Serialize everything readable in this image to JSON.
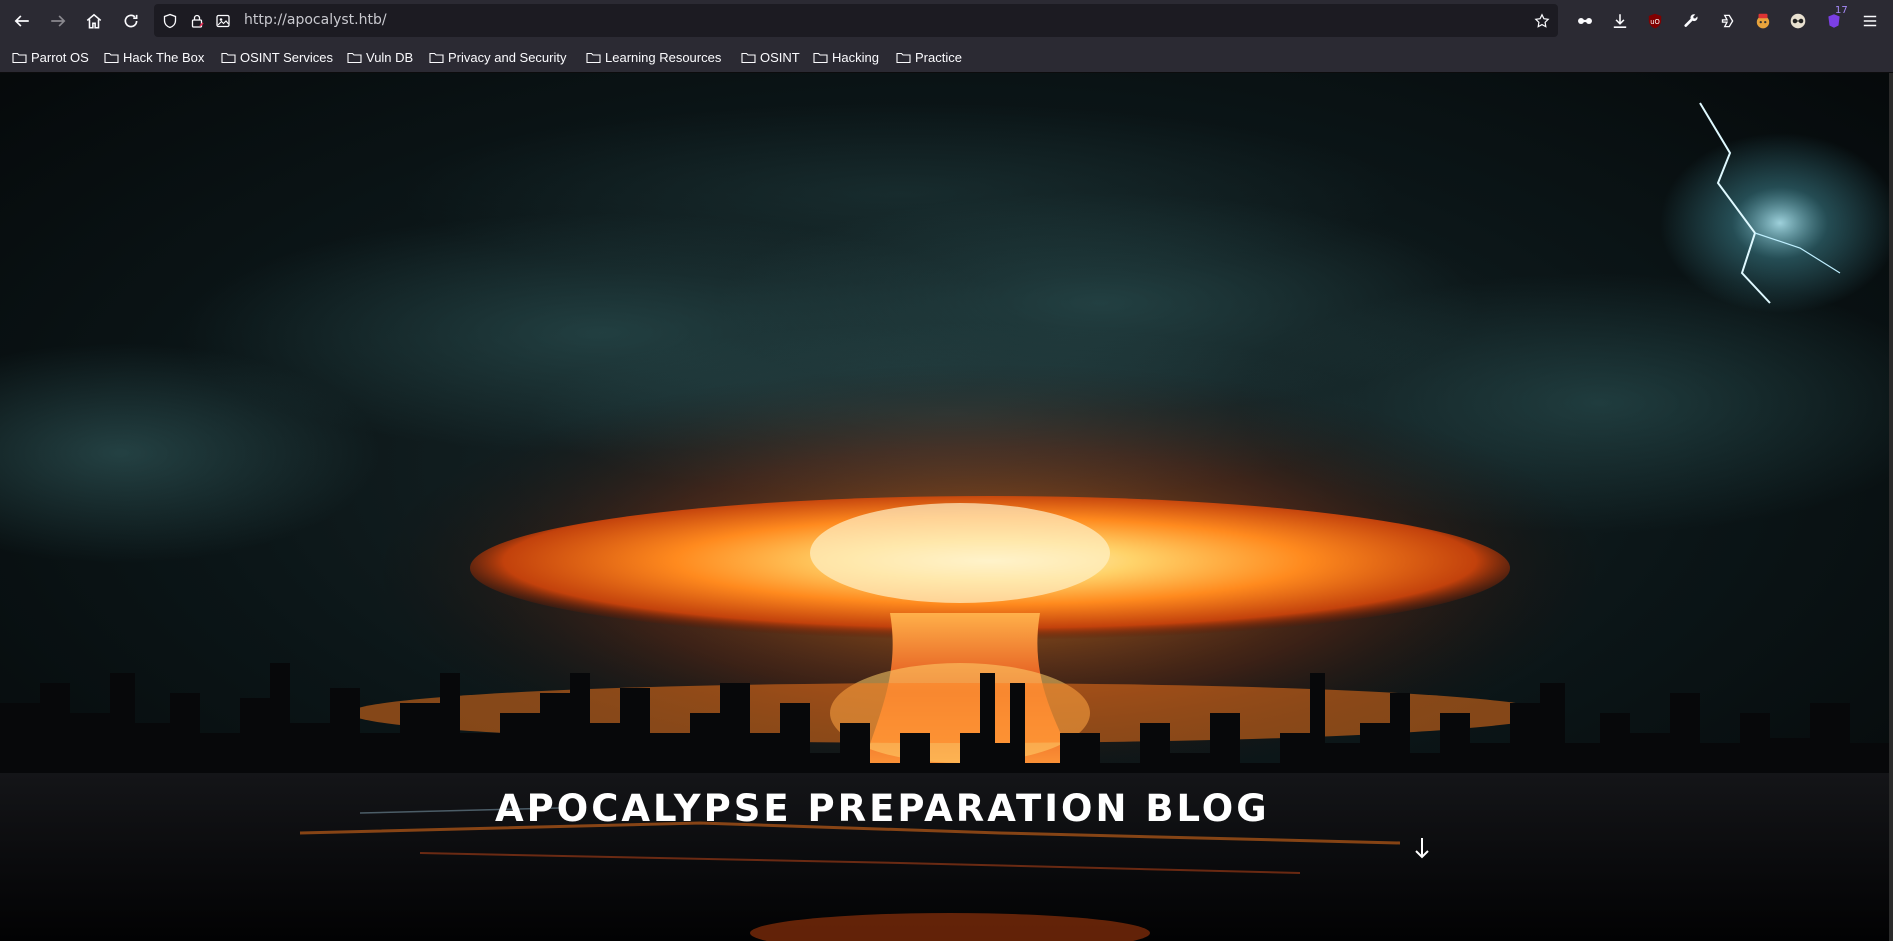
{
  "browser": {
    "url": "http://apocalyst.htb/",
    "nav_icons": [
      "back-icon",
      "forward-icon",
      "home-icon",
      "reload-icon"
    ],
    "url_icons": [
      "tracking-shield-icon",
      "lock-icon",
      "page-icon"
    ],
    "toolbar_icons": [
      "bookmark-star-icon",
      "extension-icon",
      "download-icon",
      "ublock-icon",
      "tools-icon",
      "share-icon",
      "container-icon",
      "glasses-icon",
      "notification-icon",
      "menu-icon"
    ],
    "notification_badge": "17"
  },
  "bookmarks": [
    {
      "label": "Parrot OS"
    },
    {
      "label": "Hack The Box"
    },
    {
      "label": "OSINT Services"
    },
    {
      "label": "Vuln DB"
    },
    {
      "label": "Privacy and Security"
    },
    {
      "label": "Learning Resources"
    },
    {
      "label": "OSINT"
    },
    {
      "label": "Hacking"
    },
    {
      "label": "Practice"
    }
  ],
  "page": {
    "title": "APOCALYPSE PREPARATION BLOG",
    "scroll_icon": "arrow-down-icon"
  },
  "colors": {
    "chrome": "#2b2a33",
    "urlbar": "#1c1b22",
    "explosion_core": "#ffe08a",
    "explosion_glow": "#ff6a12",
    "sky": "#0b1a1f"
  }
}
